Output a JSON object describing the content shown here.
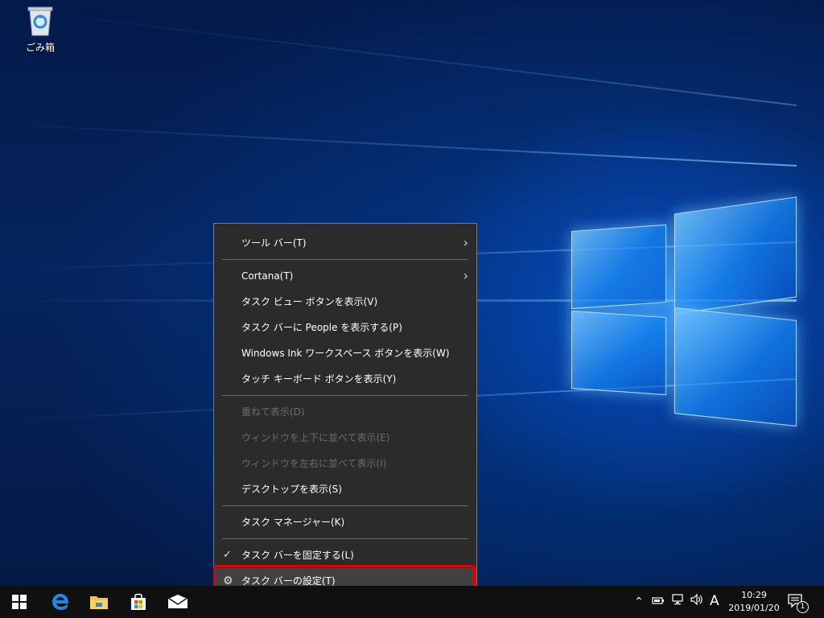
{
  "desktop": {
    "icons": [
      {
        "label": "ごみ箱",
        "icon": "recycle-bin-icon"
      }
    ]
  },
  "context_menu": {
    "items": [
      {
        "label": "ツール バー(T)",
        "submenu": true
      },
      {
        "label": "Cortana(T)",
        "submenu": true
      },
      {
        "label": "タスク ビュー ボタンを表示(V)"
      },
      {
        "label": "タスク バーに People を表示する(P)"
      },
      {
        "label": "Windows Ink ワークスペース ボタンを表示(W)"
      },
      {
        "label": "タッチ キーボード ボタンを表示(Y)"
      },
      {
        "label": "重ねて表示(D)",
        "disabled": true
      },
      {
        "label": "ウィンドウを上下に並べて表示(E)",
        "disabled": true
      },
      {
        "label": "ウィンドウを左右に並べて表示(I)",
        "disabled": true
      },
      {
        "label": "デスクトップを表示(S)"
      },
      {
        "label": "タスク マネージャー(K)"
      },
      {
        "label": "タスク バーを固定する(L)",
        "checked": true
      },
      {
        "label": "タスク バーの設定(T)",
        "icon": "gear-icon",
        "highlighted": true
      }
    ],
    "highlight_color": "#e00000"
  },
  "taskbar": {
    "pinned": [
      {
        "name": "start",
        "icon": "windows-logo-icon"
      },
      {
        "name": "edge",
        "icon": "edge-icon"
      },
      {
        "name": "file-explorer",
        "icon": "folder-icon"
      },
      {
        "name": "store",
        "icon": "store-icon"
      },
      {
        "name": "mail",
        "icon": "mail-icon"
      }
    ],
    "tray": {
      "ime": "A",
      "time": "10:29",
      "date": "2019/01/20",
      "notification_count": "1"
    },
    "colors": {
      "taskbar_bg": "#101010",
      "edge_blue": "#1e88e5",
      "folder_yellow": "#f6c343"
    }
  }
}
